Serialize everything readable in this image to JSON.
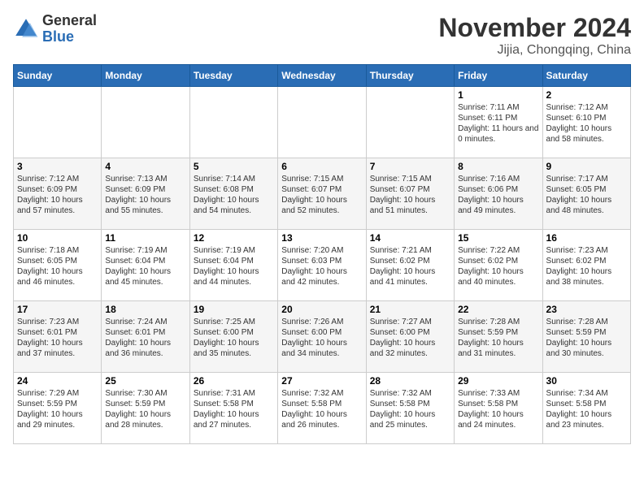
{
  "header": {
    "logo_general": "General",
    "logo_blue": "Blue",
    "month_title": "November 2024",
    "location": "Jijia, Chongqing, China"
  },
  "days_of_week": [
    "Sunday",
    "Monday",
    "Tuesday",
    "Wednesday",
    "Thursday",
    "Friday",
    "Saturday"
  ],
  "weeks": [
    [
      {
        "day": "",
        "info": ""
      },
      {
        "day": "",
        "info": ""
      },
      {
        "day": "",
        "info": ""
      },
      {
        "day": "",
        "info": ""
      },
      {
        "day": "",
        "info": ""
      },
      {
        "day": "1",
        "info": "Sunrise: 7:11 AM\nSunset: 6:11 PM\nDaylight: 11 hours and 0 minutes."
      },
      {
        "day": "2",
        "info": "Sunrise: 7:12 AM\nSunset: 6:10 PM\nDaylight: 10 hours and 58 minutes."
      }
    ],
    [
      {
        "day": "3",
        "info": "Sunrise: 7:12 AM\nSunset: 6:09 PM\nDaylight: 10 hours and 57 minutes."
      },
      {
        "day": "4",
        "info": "Sunrise: 7:13 AM\nSunset: 6:09 PM\nDaylight: 10 hours and 55 minutes."
      },
      {
        "day": "5",
        "info": "Sunrise: 7:14 AM\nSunset: 6:08 PM\nDaylight: 10 hours and 54 minutes."
      },
      {
        "day": "6",
        "info": "Sunrise: 7:15 AM\nSunset: 6:07 PM\nDaylight: 10 hours and 52 minutes."
      },
      {
        "day": "7",
        "info": "Sunrise: 7:15 AM\nSunset: 6:07 PM\nDaylight: 10 hours and 51 minutes."
      },
      {
        "day": "8",
        "info": "Sunrise: 7:16 AM\nSunset: 6:06 PM\nDaylight: 10 hours and 49 minutes."
      },
      {
        "day": "9",
        "info": "Sunrise: 7:17 AM\nSunset: 6:05 PM\nDaylight: 10 hours and 48 minutes."
      }
    ],
    [
      {
        "day": "10",
        "info": "Sunrise: 7:18 AM\nSunset: 6:05 PM\nDaylight: 10 hours and 46 minutes."
      },
      {
        "day": "11",
        "info": "Sunrise: 7:19 AM\nSunset: 6:04 PM\nDaylight: 10 hours and 45 minutes."
      },
      {
        "day": "12",
        "info": "Sunrise: 7:19 AM\nSunset: 6:04 PM\nDaylight: 10 hours and 44 minutes."
      },
      {
        "day": "13",
        "info": "Sunrise: 7:20 AM\nSunset: 6:03 PM\nDaylight: 10 hours and 42 minutes."
      },
      {
        "day": "14",
        "info": "Sunrise: 7:21 AM\nSunset: 6:02 PM\nDaylight: 10 hours and 41 minutes."
      },
      {
        "day": "15",
        "info": "Sunrise: 7:22 AM\nSunset: 6:02 PM\nDaylight: 10 hours and 40 minutes."
      },
      {
        "day": "16",
        "info": "Sunrise: 7:23 AM\nSunset: 6:02 PM\nDaylight: 10 hours and 38 minutes."
      }
    ],
    [
      {
        "day": "17",
        "info": "Sunrise: 7:23 AM\nSunset: 6:01 PM\nDaylight: 10 hours and 37 minutes."
      },
      {
        "day": "18",
        "info": "Sunrise: 7:24 AM\nSunset: 6:01 PM\nDaylight: 10 hours and 36 minutes."
      },
      {
        "day": "19",
        "info": "Sunrise: 7:25 AM\nSunset: 6:00 PM\nDaylight: 10 hours and 35 minutes."
      },
      {
        "day": "20",
        "info": "Sunrise: 7:26 AM\nSunset: 6:00 PM\nDaylight: 10 hours and 34 minutes."
      },
      {
        "day": "21",
        "info": "Sunrise: 7:27 AM\nSunset: 6:00 PM\nDaylight: 10 hours and 32 minutes."
      },
      {
        "day": "22",
        "info": "Sunrise: 7:28 AM\nSunset: 5:59 PM\nDaylight: 10 hours and 31 minutes."
      },
      {
        "day": "23",
        "info": "Sunrise: 7:28 AM\nSunset: 5:59 PM\nDaylight: 10 hours and 30 minutes."
      }
    ],
    [
      {
        "day": "24",
        "info": "Sunrise: 7:29 AM\nSunset: 5:59 PM\nDaylight: 10 hours and 29 minutes."
      },
      {
        "day": "25",
        "info": "Sunrise: 7:30 AM\nSunset: 5:59 PM\nDaylight: 10 hours and 28 minutes."
      },
      {
        "day": "26",
        "info": "Sunrise: 7:31 AM\nSunset: 5:58 PM\nDaylight: 10 hours and 27 minutes."
      },
      {
        "day": "27",
        "info": "Sunrise: 7:32 AM\nSunset: 5:58 PM\nDaylight: 10 hours and 26 minutes."
      },
      {
        "day": "28",
        "info": "Sunrise: 7:32 AM\nSunset: 5:58 PM\nDaylight: 10 hours and 25 minutes."
      },
      {
        "day": "29",
        "info": "Sunrise: 7:33 AM\nSunset: 5:58 PM\nDaylight: 10 hours and 24 minutes."
      },
      {
        "day": "30",
        "info": "Sunrise: 7:34 AM\nSunset: 5:58 PM\nDaylight: 10 hours and 23 minutes."
      }
    ]
  ]
}
